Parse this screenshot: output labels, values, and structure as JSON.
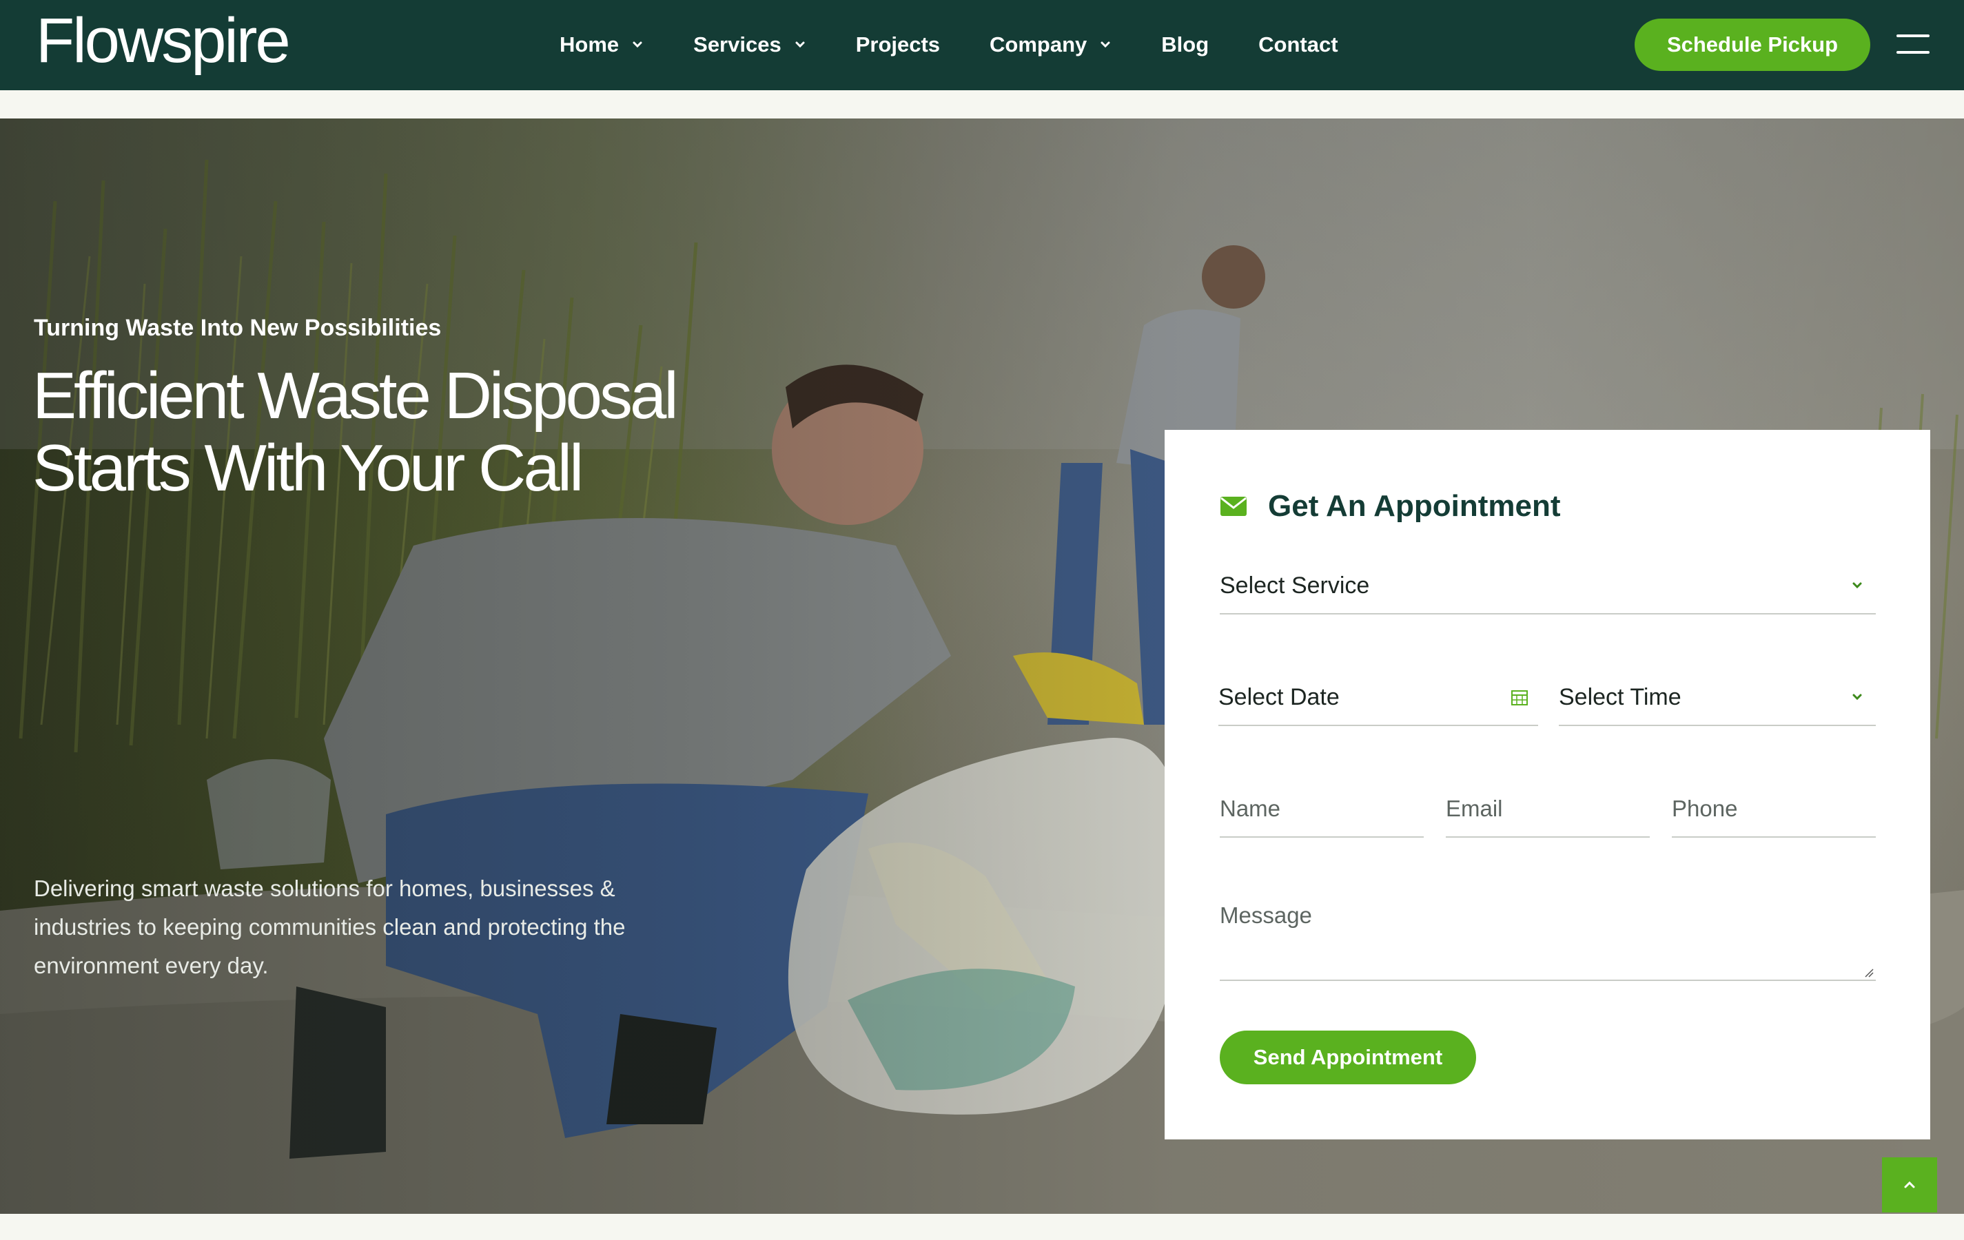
{
  "brand": {
    "logo_text": "Flowspire"
  },
  "nav": {
    "items": [
      {
        "label": "Home",
        "has_dropdown": true
      },
      {
        "label": "Services",
        "has_dropdown": true
      },
      {
        "label": "Projects",
        "has_dropdown": false
      },
      {
        "label": "Company",
        "has_dropdown": true
      },
      {
        "label": "Blog",
        "has_dropdown": false
      },
      {
        "label": "Contact",
        "has_dropdown": false
      }
    ],
    "cta_label": "Schedule Pickup",
    "menu_icon": "hamburger-icon"
  },
  "hero": {
    "eyebrow": "Turning Waste Into New Possibilities",
    "headline_line1": "Efficient Waste Disposal",
    "headline_line2": "Starts With Your Call",
    "description": "Delivering smart waste solutions for homes, businesses & industries to keeping communities clean and protecting the environment every day."
  },
  "appointment_form": {
    "title": "Get An Appointment",
    "title_icon": "envelope-icon",
    "service_select": "Select Service",
    "date_select": "Select Date",
    "date_icon": "calendar-icon",
    "time_select": "Select Time",
    "name_placeholder": "Name",
    "email_placeholder": "Email",
    "phone_placeholder": "Phone",
    "message_placeholder": "Message",
    "submit_label": "Send Appointment"
  },
  "back_to_top_icon": "chevron-up-icon",
  "colors": {
    "header_bg": "#143c35",
    "accent_green": "#5ab11f",
    "title_dark": "#143c35",
    "card_bg": "#ffffff"
  }
}
